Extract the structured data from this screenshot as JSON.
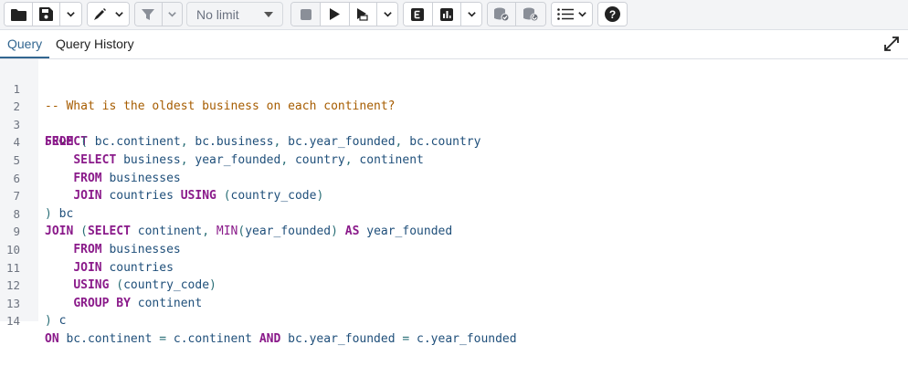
{
  "toolbar": {
    "limit_label": "No limit",
    "buttons": [
      {
        "name": "open-file",
        "icon": "folder-icon"
      },
      {
        "name": "save",
        "icon": "save-icon"
      },
      {
        "name": "edit",
        "icon": "pen-icon"
      },
      {
        "name": "filter",
        "icon": "filter-icon"
      },
      {
        "name": "stop",
        "icon": "stop-icon"
      },
      {
        "name": "execute",
        "icon": "play-icon"
      },
      {
        "name": "execute-script",
        "icon": "play-script-icon"
      },
      {
        "name": "explain",
        "icon": "explain-icon"
      },
      {
        "name": "explain-analyze",
        "icon": "chart-icon"
      },
      {
        "name": "commit",
        "icon": "database-check-icon"
      },
      {
        "name": "rollback",
        "icon": "database-undo-icon"
      },
      {
        "name": "macros",
        "icon": "list-icon"
      },
      {
        "name": "help",
        "icon": "help-icon"
      }
    ]
  },
  "tabs": [
    {
      "label": "Query",
      "active": true
    },
    {
      "label": "Query History",
      "active": false
    }
  ],
  "editor": {
    "lines": [
      {
        "n": "1",
        "text": "-- What is the oldest business on each continent?"
      },
      {
        "n": "2",
        "text": "SELECT bc.continent, bc.business, bc.year_founded, bc.country",
        "fold": true
      },
      {
        "n": "3",
        "text": "FROM ("
      },
      {
        "n": "4",
        "text": "    SELECT business, year_founded, country, continent"
      },
      {
        "n": "5",
        "text": "    FROM businesses"
      },
      {
        "n": "6",
        "text": "    JOIN countries USING (country_code)"
      },
      {
        "n": "7",
        "text": ") bc"
      },
      {
        "n": "8",
        "text": "JOIN (SELECT continent, MIN(year_founded) AS year_founded"
      },
      {
        "n": "9",
        "text": "    FROM businesses"
      },
      {
        "n": "10",
        "text": "    JOIN countries"
      },
      {
        "n": "11",
        "text": "    USING (country_code)"
      },
      {
        "n": "12",
        "text": "    GROUP BY continent"
      },
      {
        "n": "13",
        "text": ") c"
      },
      {
        "n": "14",
        "text": "ON bc.continent = c.continent AND bc.year_founded = c.year_founded"
      }
    ]
  },
  "colors": {
    "accent": "#326690",
    "keyword": "#8a1a8a",
    "comment": "#a65c00",
    "identifier": "#1f4f7a"
  }
}
